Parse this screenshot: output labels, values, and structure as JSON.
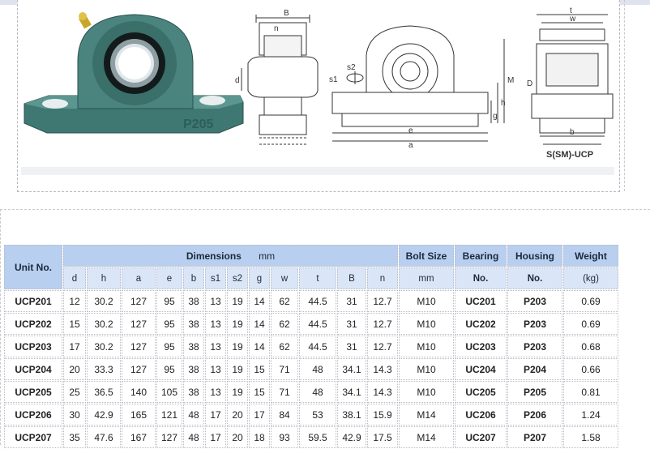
{
  "drawing": {
    "casting_mark": "P205",
    "caption": "S(SM)-UCP",
    "dim_labels": {
      "B": "B",
      "n": "n",
      "d": "d",
      "s1": "s1",
      "s2": "s2",
      "M": "M",
      "h": "h",
      "g": "g",
      "e": "e",
      "a": "a",
      "t": "t",
      "b": "b",
      "w": "w",
      "D": "D"
    }
  },
  "table": {
    "header": {
      "unit_no": "Unit No.",
      "dimensions": "Dimensions",
      "dimensions_unit": "mm",
      "bolt_size": "Bolt Size",
      "bolt_unit": "mm",
      "bearing": "Bearing",
      "bearing_no": "No.",
      "housing": "Housing",
      "housing_no": "No.",
      "weight": "Weight",
      "weight_unit": "(kg)",
      "dim_cols": [
        "d",
        "h",
        "a",
        "e",
        "b",
        "s1",
        "s2",
        "g",
        "w",
        "t",
        "B",
        "n"
      ]
    },
    "rows": [
      {
        "unit": "UCP201",
        "d": "12",
        "h": "30.2",
        "a": "127",
        "e": "95",
        "b": "38",
        "s1": "13",
        "s2": "19",
        "g": "14",
        "w": "62",
        "t": "44.5",
        "B": "31",
        "n": "12.7",
        "bolt": "M10",
        "bearing": "UC201",
        "housing": "P203",
        "weight": "0.69"
      },
      {
        "unit": "UCP202",
        "d": "15",
        "h": "30.2",
        "a": "127",
        "e": "95",
        "b": "38",
        "s1": "13",
        "s2": "19",
        "g": "14",
        "w": "62",
        "t": "44.5",
        "B": "31",
        "n": "12.7",
        "bolt": "M10",
        "bearing": "UC202",
        "housing": "P203",
        "weight": "0.69"
      },
      {
        "unit": "UCP203",
        "d": "17",
        "h": "30.2",
        "a": "127",
        "e": "95",
        "b": "38",
        "s1": "13",
        "s2": "19",
        "g": "14",
        "w": "62",
        "t": "44.5",
        "B": "31",
        "n": "12.7",
        "bolt": "M10",
        "bearing": "UC203",
        "housing": "P203",
        "weight": "0.68"
      },
      {
        "unit": "UCP204",
        "d": "20",
        "h": "33.3",
        "a": "127",
        "e": "95",
        "b": "38",
        "s1": "13",
        "s2": "19",
        "g": "15",
        "w": "71",
        "t": "48",
        "B": "34.1",
        "n": "14.3",
        "bolt": "M10",
        "bearing": "UC204",
        "housing": "P204",
        "weight": "0.66"
      },
      {
        "unit": "UCP205",
        "d": "25",
        "h": "36.5",
        "a": "140",
        "e": "105",
        "b": "38",
        "s1": "13",
        "s2": "19",
        "g": "15",
        "w": "71",
        "t": "48",
        "B": "34.1",
        "n": "14.3",
        "bolt": "M10",
        "bearing": "UC205",
        "housing": "P205",
        "weight": "0.81"
      },
      {
        "unit": "UCP206",
        "d": "30",
        "h": "42.9",
        "a": "165",
        "e": "121",
        "b": "48",
        "s1": "17",
        "s2": "20",
        "g": "17",
        "w": "84",
        "t": "53",
        "B": "38.1",
        "n": "15.9",
        "bolt": "M14",
        "bearing": "UC206",
        "housing": "P206",
        "weight": "1.24"
      },
      {
        "unit": "UCP207",
        "d": "35",
        "h": "47.6",
        "a": "167",
        "e": "127",
        "b": "48",
        "s1": "17",
        "s2": "20",
        "g": "18",
        "w": "93",
        "t": "59.5",
        "B": "42.9",
        "n": "17.5",
        "bolt": "M14",
        "bearing": "UC207",
        "housing": "P207",
        "weight": "1.58"
      }
    ]
  }
}
